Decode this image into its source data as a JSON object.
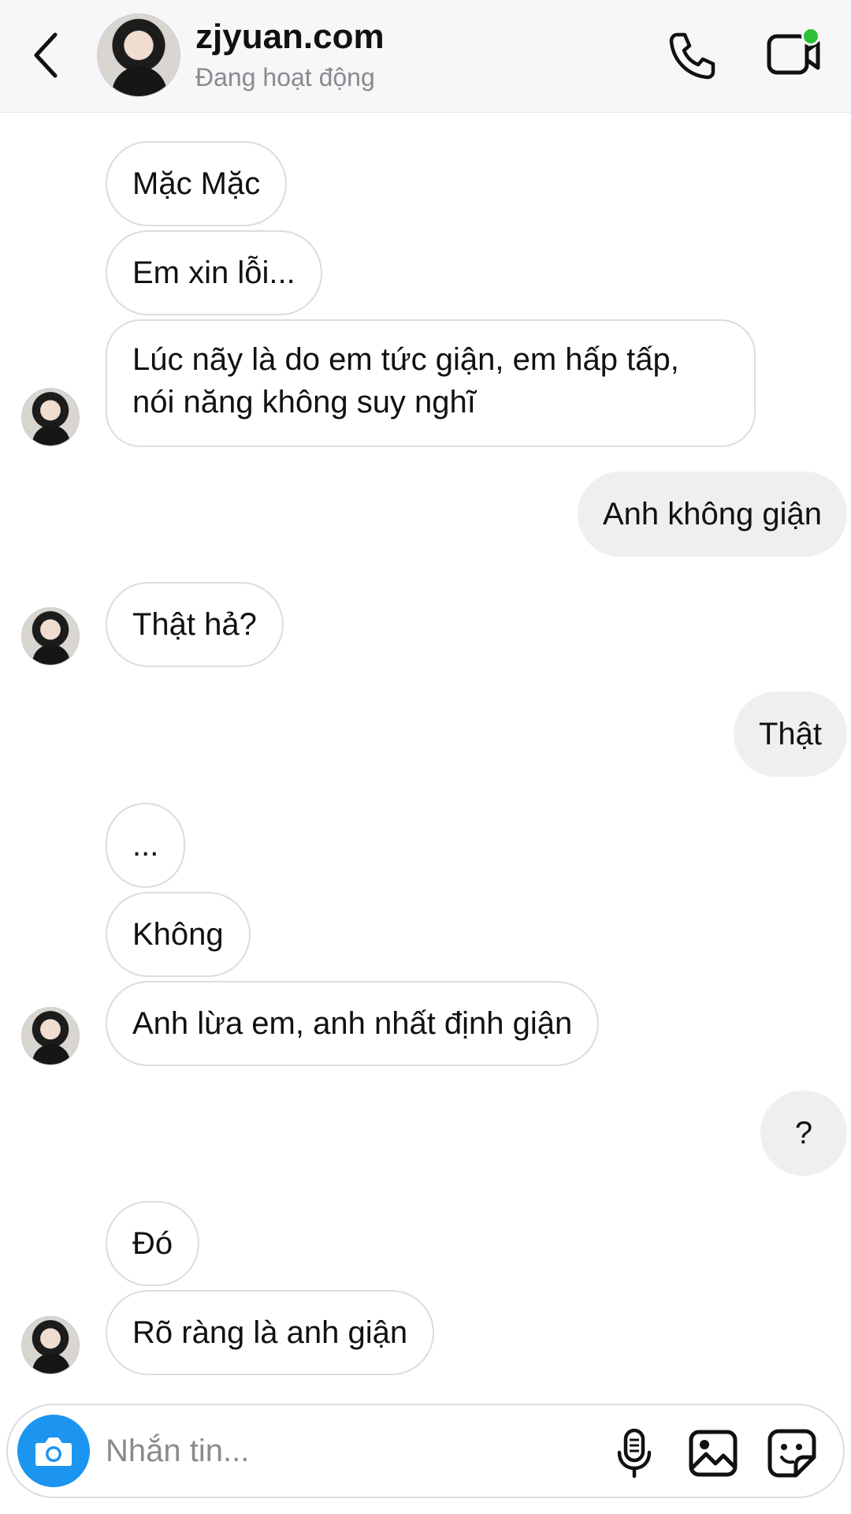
{
  "header": {
    "title": "zjyuan.com",
    "status": "Đang hoạt động",
    "online_color": "#2bc138",
    "icons": [
      "back-chevron-icon",
      "phone-icon",
      "video-call-icon"
    ]
  },
  "messages": [
    {
      "side": "in",
      "text": "Mặc Mặc"
    },
    {
      "side": "in",
      "text": "Em xin lỗi..."
    },
    {
      "side": "in",
      "text": "Lúc nãy là do em tức giận, em hấp tấp, nói năng không suy nghĩ"
    },
    {
      "side": "out",
      "text": "Anh không giận"
    },
    {
      "side": "in",
      "text": "Thật hả?"
    },
    {
      "side": "out",
      "text": "Thật"
    },
    {
      "side": "in",
      "text": "..."
    },
    {
      "side": "in",
      "text": "Không"
    },
    {
      "side": "in",
      "text": "Anh lừa em, anh nhất định giận"
    },
    {
      "side": "out",
      "text": "?"
    },
    {
      "side": "in",
      "text": "Đó"
    },
    {
      "side": "in",
      "text": "Rõ ràng là anh giận"
    }
  ],
  "composer": {
    "placeholder": "Nhắn tin...",
    "camera_color": "#1b95f0",
    "icons": [
      "camera-icon",
      "microphone-icon",
      "gallery-icon",
      "sticker-icon"
    ]
  }
}
